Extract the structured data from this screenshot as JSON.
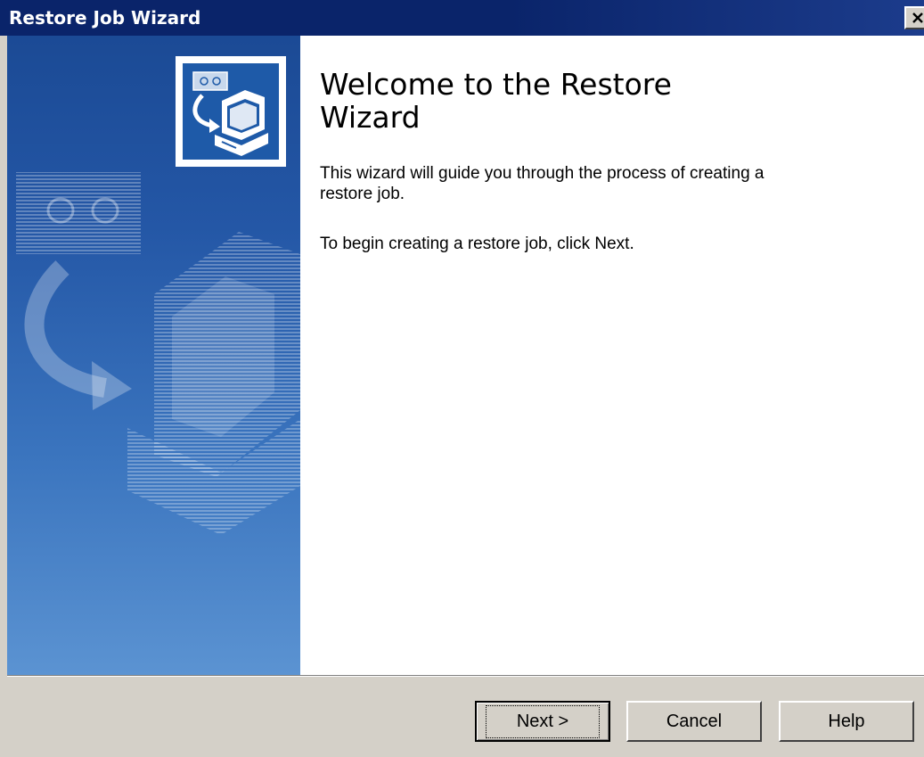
{
  "window": {
    "title": "Restore Job Wizard"
  },
  "main": {
    "heading": "Welcome to the Restore Wizard",
    "intro": "This wizard will guide you through the process of creating a restore job.",
    "instruction": "To begin creating a restore job, click Next."
  },
  "buttons": {
    "next": "Next >",
    "cancel": "Cancel",
    "help": "Help"
  },
  "colors": {
    "titlebar": "#0a246a",
    "sidebar_top": "#1b4a95",
    "sidebar_bottom": "#5b93d2",
    "dialog_face": "#d4d0c8"
  },
  "icons": {
    "logo": "restore-computer-icon",
    "watermark": "restore-computer-watermark-icon",
    "close": "close-icon"
  }
}
